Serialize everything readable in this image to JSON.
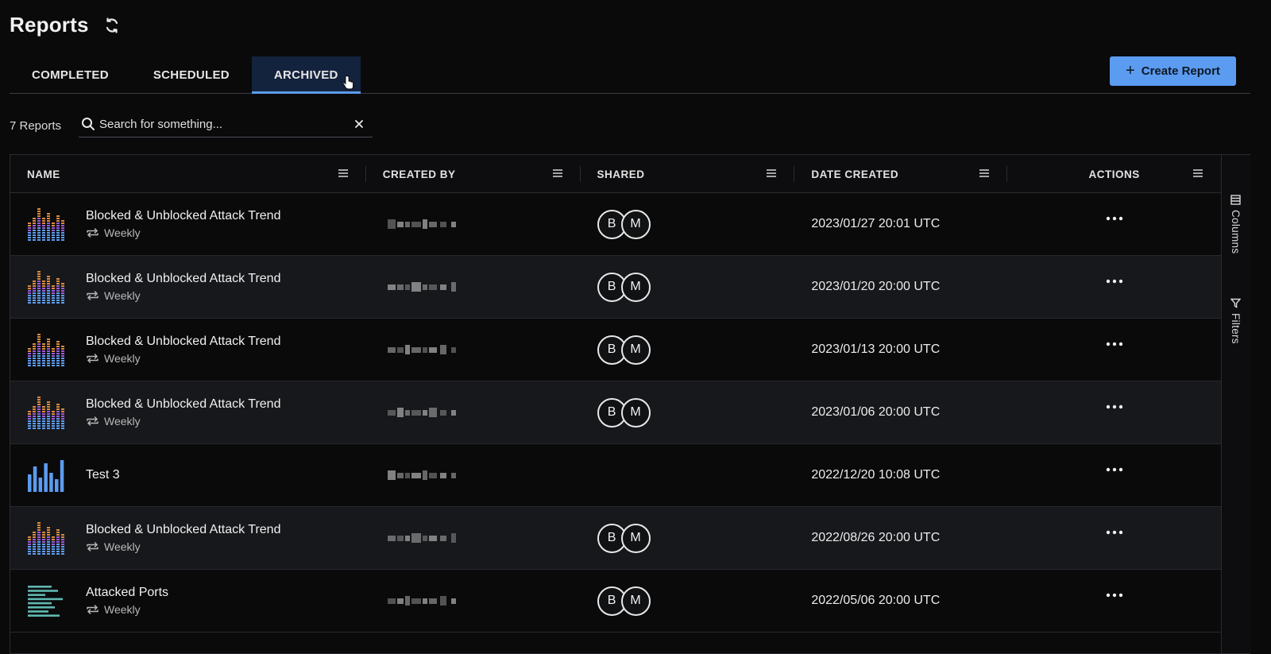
{
  "header": {
    "title": "Reports",
    "refresh_icon": "refresh-icon"
  },
  "tabs": [
    {
      "label": "COMPLETED",
      "active": false
    },
    {
      "label": "SCHEDULED",
      "active": false
    },
    {
      "label": "ARCHIVED",
      "active": true
    }
  ],
  "create_button": {
    "label": "Create Report",
    "icon": "plus-icon",
    "color": "#5b9cf0"
  },
  "toolbar": {
    "count_label": "7 Reports",
    "search_placeholder": "Search for something..."
  },
  "table": {
    "columns": [
      "NAME",
      "CREATED BY",
      "SHARED",
      "DATE CREATED",
      "ACTIONS"
    ],
    "rows": [
      {
        "name": "Blocked & Unblocked Attack Trend",
        "schedule": "Weekly",
        "thumb": "stacked-bar",
        "shared": [
          "B",
          "M"
        ],
        "date": "2023/01/27 20:01 UTC"
      },
      {
        "name": "Blocked & Unblocked Attack Trend",
        "schedule": "Weekly",
        "thumb": "stacked-bar",
        "shared": [
          "B",
          "M"
        ],
        "date": "2023/01/20 20:00 UTC"
      },
      {
        "name": "Blocked & Unblocked Attack Trend",
        "schedule": "Weekly",
        "thumb": "stacked-bar",
        "shared": [
          "B",
          "M"
        ],
        "date": "2023/01/13 20:00 UTC"
      },
      {
        "name": "Blocked & Unblocked Attack Trend",
        "schedule": "Weekly",
        "thumb": "stacked-bar",
        "shared": [
          "B",
          "M"
        ],
        "date": "2023/01/06 20:00 UTC"
      },
      {
        "name": "Test 3",
        "schedule": "",
        "thumb": "bar",
        "shared": [],
        "date": "2022/12/20 10:08 UTC"
      },
      {
        "name": "Blocked & Unblocked Attack Trend",
        "schedule": "Weekly",
        "thumb": "stacked-bar",
        "shared": [
          "B",
          "M"
        ],
        "date": "2022/08/26 20:00 UTC"
      },
      {
        "name": "Attacked Ports",
        "schedule": "Weekly",
        "thumb": "horizontal-bar",
        "shared": [
          "B",
          "M"
        ],
        "date": "2022/05/06 20:00 UTC"
      }
    ]
  },
  "side_panel": {
    "columns_label": "Columns",
    "filters_label": "Filters"
  },
  "colors": {
    "accent": "#5b9cf0",
    "active_tab_bg": "#14233d",
    "thumb_orange": "#d98a3e",
    "thumb_purple": "#9a5ad6",
    "thumb_blue": "#5b9cf0",
    "thumb_teal": "#5fb8b0"
  }
}
